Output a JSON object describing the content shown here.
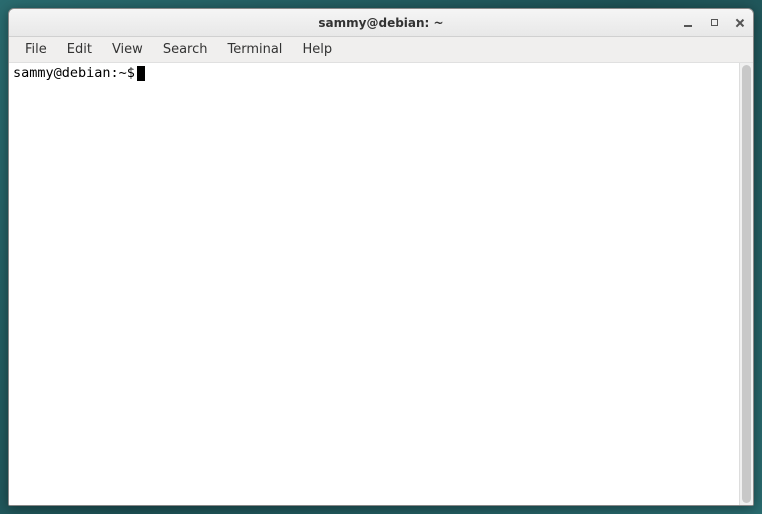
{
  "window": {
    "title": "sammy@debian: ~"
  },
  "menubar": {
    "items": [
      {
        "label": "File"
      },
      {
        "label": "Edit"
      },
      {
        "label": "View"
      },
      {
        "label": "Search"
      },
      {
        "label": "Terminal"
      },
      {
        "label": "Help"
      }
    ]
  },
  "terminal": {
    "prompt": "sammy@debian:~$"
  }
}
